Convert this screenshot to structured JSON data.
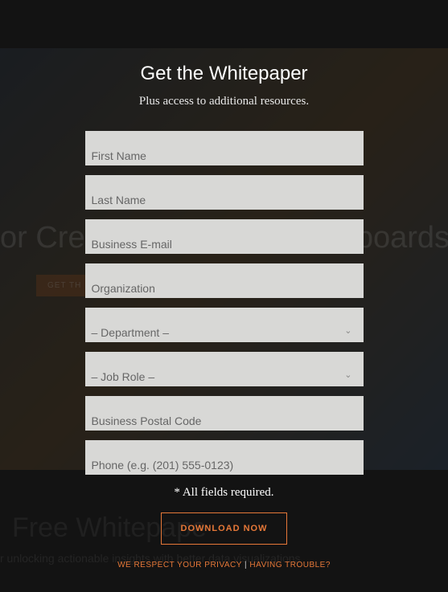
{
  "background": {
    "headline": "or Creating Effective Dashboards",
    "cta": "GET TH",
    "subhead": "Free Whitepape",
    "desc": "r unlocking actionable insights with better data visualizations"
  },
  "modal": {
    "title": "Get the Whitepaper",
    "subtitle": "Plus access to additional resources.",
    "fields": {
      "first_name": "First Name",
      "last_name": "Last Name",
      "email": "Business E-mail",
      "organization": "Organization",
      "department": "– Department –",
      "job_role": "– Job Role –",
      "postal": "Business Postal Code",
      "phone": "Phone (e.g. (201) 555-0123)"
    },
    "required": "* All fields required.",
    "download": "DOWNLOAD NOW",
    "privacy": "WE RESPECT YOUR PRIVACY",
    "separator": " | ",
    "trouble": "HAVING TROUBLE?"
  }
}
